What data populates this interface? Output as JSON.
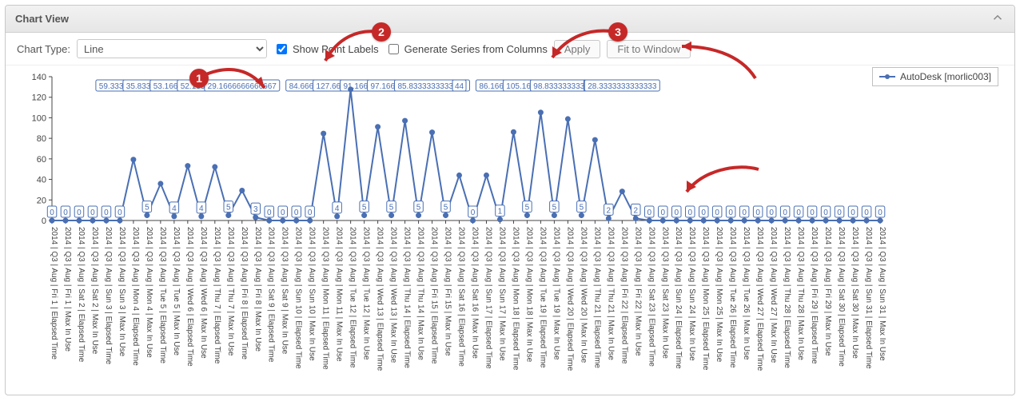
{
  "panel": {
    "title": "Chart View"
  },
  "toolbar": {
    "chart_type_label": "Chart Type:",
    "chart_type_value": "Line",
    "show_point_labels": "Show Point Labels",
    "generate_series": "Generate Series from Columns",
    "apply": "Apply",
    "fit": "Fit to Window"
  },
  "legend": {
    "series_name": "AutoDesk [morlic003]"
  },
  "callouts": {
    "one": "1",
    "two": "2",
    "three": "3"
  },
  "chart_data": {
    "type": "line",
    "title": "",
    "xlabel": "",
    "ylabel": "",
    "ylim": [
      0,
      140
    ],
    "yticks": [
      0,
      20,
      40,
      60,
      80,
      100,
      120,
      140
    ],
    "series": [
      {
        "name": "AutoDesk [morlic003]",
        "color": "#4a6fb3"
      }
    ],
    "categories": [
      "2014 | Q3 | Aug | Fri 1 | Elapsed Time",
      "2014 | Q3 | Aug | Fri 1 | Max In Use",
      "2014 | Q3 | Aug | Sat 2 | Elapsed Time",
      "2014 | Q3 | Aug | Sat 2 | Max In Use",
      "2014 | Q3 | Aug | Sun 3 | Elapsed Time",
      "2014 | Q3 | Aug | Sun 3 | Max In Use",
      "2014 | Q3 | Aug | Mon 4 | Elapsed Time",
      "2014 | Q3 | Aug | Mon 4 | Max In Use",
      "2014 | Q3 | Aug | Tue 5 | Elapsed Time",
      "2014 | Q3 | Aug | Tue 5 | Max In Use",
      "2014 | Q3 | Aug | Wed 6 | Elapsed Time",
      "2014 | Q3 | Aug | Wed 6 | Max In Use",
      "2014 | Q3 | Aug | Thu 7 | Elapsed Time",
      "2014 | Q3 | Aug | Thu 7 | Max In Use",
      "2014 | Q3 | Aug | Fri 8 | Elapsed Time",
      "2014 | Q3 | Aug | Fri 8 | Max In Use",
      "2014 | Q3 | Aug | Sat 9 | Elapsed Time",
      "2014 | Q3 | Aug | Sat 9 | Max In Use",
      "2014 | Q3 | Aug | Sun 10 | Elapsed Time",
      "2014 | Q3 | Aug | Sun 10 | Max In Use",
      "2014 | Q3 | Aug | Mon 11 | Elapsed Time",
      "2014 | Q3 | Aug | Mon 11 | Max In Use",
      "2014 | Q3 | Aug | Tue 12 | Elapsed Time",
      "2014 | Q3 | Aug | Tue 12 | Max In Use",
      "2014 | Q3 | Aug | Wed 13 | Elapsed Time",
      "2014 | Q3 | Aug | Wed 13 | Max In Use",
      "2014 | Q3 | Aug | Thu 14 | Elapsed Time",
      "2014 | Q3 | Aug | Thu 14 | Max In Use",
      "2014 | Q3 | Aug | Fri 15 | Elapsed Time",
      "2014 | Q3 | Aug | Fri 15 | Max In Use",
      "2014 | Q3 | Aug | Sat 16 | Elapsed Time",
      "2014 | Q3 | Aug | Sat 16 | Max In Use",
      "2014 | Q3 | Aug | Sun 17 | Elapsed Time",
      "2014 | Q3 | Aug | Sun 17 | Max In Use",
      "2014 | Q3 | Aug | Mon 18 | Elapsed Time",
      "2014 | Q3 | Aug | Mon 18 | Max In Use",
      "2014 | Q3 | Aug | Tue 19 | Elapsed Time",
      "2014 | Q3 | Aug | Tue 19 | Max In Use",
      "2014 | Q3 | Aug | Wed 20 | Elapsed Time",
      "2014 | Q3 | Aug | Wed 20 | Max In Use",
      "2014 | Q3 | Aug | Thu 21 | Elapsed Time",
      "2014 | Q3 | Aug | Thu 21 | Max In Use",
      "2014 | Q3 | Aug | Fri 22 | Elapsed Time",
      "2014 | Q3 | Aug | Fri 22 | Max In Use",
      "2014 | Q3 | Aug | Sat 23 | Elapsed Time",
      "2014 | Q3 | Aug | Sat 23 | Max In Use",
      "2014 | Q3 | Aug | Sun 24 | Elapsed Time",
      "2014 | Q3 | Aug | Sun 24 | Max In Use",
      "2014 | Q3 | Aug | Mon 25 | Elapsed Time",
      "2014 | Q3 | Aug | Mon 25 | Max In Use",
      "2014 | Q3 | Aug | Tue 26 | Elapsed Time",
      "2014 | Q3 | Aug | Tue 26 | Max In Use",
      "2014 | Q3 | Aug | Wed 27 | Elapsed Time",
      "2014 | Q3 | Aug | Wed 27 | Max In Use",
      "2014 | Q3 | Aug | Thu 28 | Elapsed Time",
      "2014 | Q3 | Aug | Thu 28 | Max In Use",
      "2014 | Q3 | Aug | Fri 29 | Elapsed Time",
      "2014 | Q3 | Aug | Fri 29 | Max In Use",
      "2014 | Q3 | Aug | Sat 30 | Elapsed Time",
      "2014 | Q3 | Aug | Sat 30 | Max In Use",
      "2014 | Q3 | Aug | Sun 31 | Elapsed Time",
      "2014 | Q3 | Aug | Sun 31 | Max In Use"
    ],
    "values": [
      0,
      0,
      0,
      0,
      0,
      0,
      59.3333333333333,
      5,
      35.8333333333333,
      4,
      53.1666666666667,
      4,
      52.1666666666667,
      5,
      29.1666666666667,
      3,
      0,
      0,
      0,
      0,
      84.6666666666667,
      4,
      127.666666666667,
      5,
      91.1666666666667,
      5,
      97.1666666666667,
      5,
      85.8333333333333,
      5,
      44,
      0,
      44,
      1,
      86.1666666666667,
      5,
      105.166666666667,
      5,
      98.8333333333333,
      5,
      78.5,
      2,
      28.3333333333333,
      2,
      0,
      0,
      0,
      0,
      0,
      0,
      0,
      0,
      0,
      0,
      0,
      0,
      0,
      0,
      0,
      0,
      0,
      0
    ],
    "point_labels": [
      "0",
      "0",
      "0",
      "0",
      "0",
      "0",
      "59.3333333333333",
      "5",
      "35.8333333333333",
      "4",
      "53.1666666666667",
      "4",
      "52.1666666666667",
      "5",
      "29.1666666666667",
      "3",
      "0",
      "0",
      "0",
      "0",
      "84.6666666666667",
      "4",
      "127.666666666667",
      "5",
      "91.1666666666667",
      "5",
      "97.1666666666667",
      "5",
      "85.8333333333333",
      "5",
      "44",
      "0",
      "44",
      "1",
      "86.1666666666667",
      "5",
      "105.166666666667",
      "5",
      "98.8333333333333",
      "5",
      "78.5",
      "2",
      "28.3333333333333",
      "2",
      "0",
      "0",
      "0",
      "0",
      "0",
      "0",
      "0",
      "0",
      "0",
      "0",
      "0",
      "0",
      "0",
      "0",
      "0",
      "0",
      "0",
      "0"
    ]
  }
}
